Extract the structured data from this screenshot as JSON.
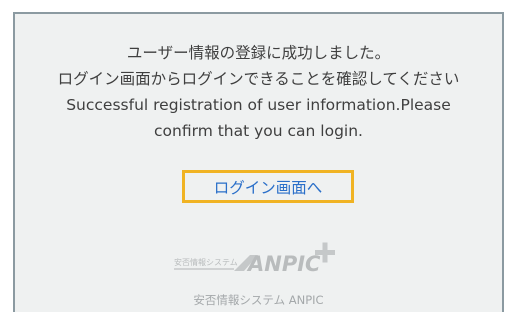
{
  "message": {
    "line1": "ユーザー情報の登録に成功しました。",
    "line2": "ログイン画面からログインできることを確認してください",
    "line3": "Successful registration of user information.Please",
    "line4": "confirm that you can login."
  },
  "login_link": {
    "label": "ログイン画面へ"
  },
  "logo": {
    "small_text": "安否情報システム",
    "brand": "ANPIC",
    "caption": "安否情報システム ANPIC"
  },
  "colors": {
    "panel_bg": "#eff1f1",
    "panel_border": "#8b9aa1",
    "link_text": "#2a6fc9",
    "highlight_border": "#f0b323",
    "logo_gray": "#b9bcbd"
  },
  "icons": [
    "anpic-logo",
    "plus-icon"
  ]
}
